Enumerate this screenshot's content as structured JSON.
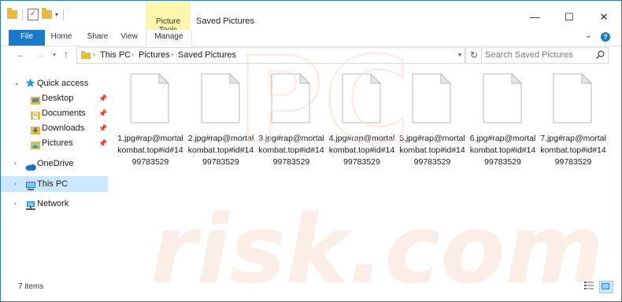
{
  "window": {
    "title": "Saved Pictures",
    "contextual_tab_group": "Picture Tools",
    "controls": {
      "minimize": "—",
      "maximize": "☐",
      "close": "✕"
    }
  },
  "ribbon": {
    "tabs": [
      {
        "label": "File",
        "active": false
      },
      {
        "label": "Home",
        "active": false
      },
      {
        "label": "Share",
        "active": false
      },
      {
        "label": "View",
        "active": false
      },
      {
        "label": "Manage",
        "active": true
      }
    ],
    "help": "?"
  },
  "address_bar": {
    "breadcrumbs": [
      "This PC",
      "Pictures",
      "Saved Pictures"
    ],
    "search_placeholder": "Search Saved Pictures"
  },
  "navigation_pane": {
    "quick_access": {
      "label": "Quick access",
      "items": [
        {
          "label": "Desktop",
          "icon": "desktop-folder-icon",
          "pinned": true
        },
        {
          "label": "Documents",
          "icon": "documents-folder-icon",
          "pinned": true
        },
        {
          "label": "Downloads",
          "icon": "downloads-folder-icon",
          "pinned": true
        },
        {
          "label": "Pictures",
          "icon": "pictures-folder-icon",
          "pinned": true
        }
      ]
    },
    "onedrive": {
      "label": "OneDrive"
    },
    "this_pc": {
      "label": "This PC",
      "selected": true
    },
    "network": {
      "label": "Network"
    }
  },
  "files": [
    {
      "name": "1.jpg#rap@mortalkombat.top#id#1499783529"
    },
    {
      "name": "2.jpg#rap@mortalkombat.top#id#1499783529"
    },
    {
      "name": "3.jpg#rap@mortalkombat.top#id#1499783529"
    },
    {
      "name": "4.jpg#rap@mortalkombat.top#id#1499783529"
    },
    {
      "name": "5.jpg#rap@mortalkombat.top#id#1499783529"
    },
    {
      "name": "6.jpg#rap@mortalkombat.top#id#1499783529"
    },
    {
      "name": "7.jpg#rap@mortalkombat.top#id#1499783529"
    }
  ],
  "status_bar": {
    "item_count": "7 items"
  },
  "watermark": {
    "text": "pc risk.com"
  },
  "colors": {
    "accent": "#1979ca",
    "selection": "#cce8ff",
    "contextual_highlight": "#fdf7ad",
    "window_border": "#2b79c9",
    "watermark": "#f6dcd0"
  }
}
